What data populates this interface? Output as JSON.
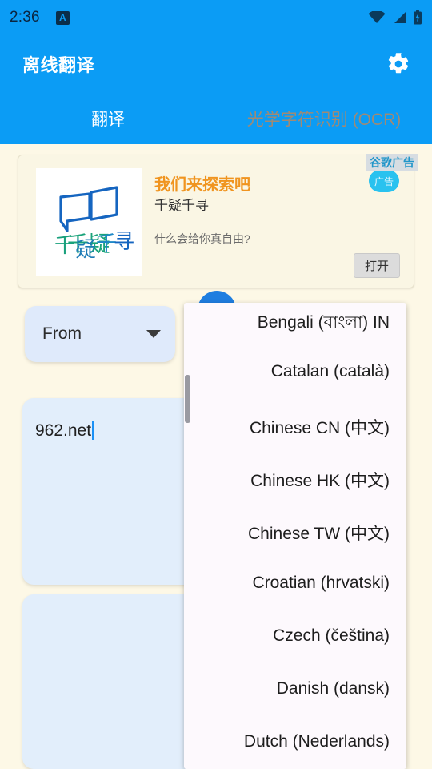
{
  "status_bar": {
    "clock": "2:36",
    "app_icon_glyph": "A",
    "icons": [
      "wifi-icon",
      "signal-icon",
      "battery-charging-icon"
    ]
  },
  "app_bar": {
    "title": "离线翻译",
    "settings_icon": "gear-icon"
  },
  "tabs": [
    {
      "label": "翻译",
      "active": true
    },
    {
      "label": "光学字符识别 (OCR)",
      "active": false
    }
  ],
  "ad": {
    "sponsor_label": "谷歌广告",
    "badge_label": "广告",
    "headline": "我们来探索吧",
    "subtitle": "千疑千寻",
    "body": "什么会给你真自由?",
    "cta_label": "打开",
    "thumbnail_text": "千疑千寻"
  },
  "translator": {
    "from_chip_label": "From",
    "swap_button": "swap-languages-button",
    "source_text": "962.net",
    "target_text": ""
  },
  "language_dropdown": {
    "items": [
      "Bengali (বাংলা) IN",
      "Catalan (català)",
      "Chinese CN (中文)",
      "Chinese HK (中文)",
      "Chinese TW (中文)",
      "Croatian (hrvatski)",
      "Czech (čeština)",
      "Danish (dansk)",
      "Dutch (Nederlands)"
    ]
  },
  "colors": {
    "brand_blue": "#0b9cf5",
    "page_background": "#fdf8e6",
    "field_blue": "#e2eefb",
    "ad_headline_orange": "#f0941f",
    "inactive_tab": "#a08a74"
  }
}
